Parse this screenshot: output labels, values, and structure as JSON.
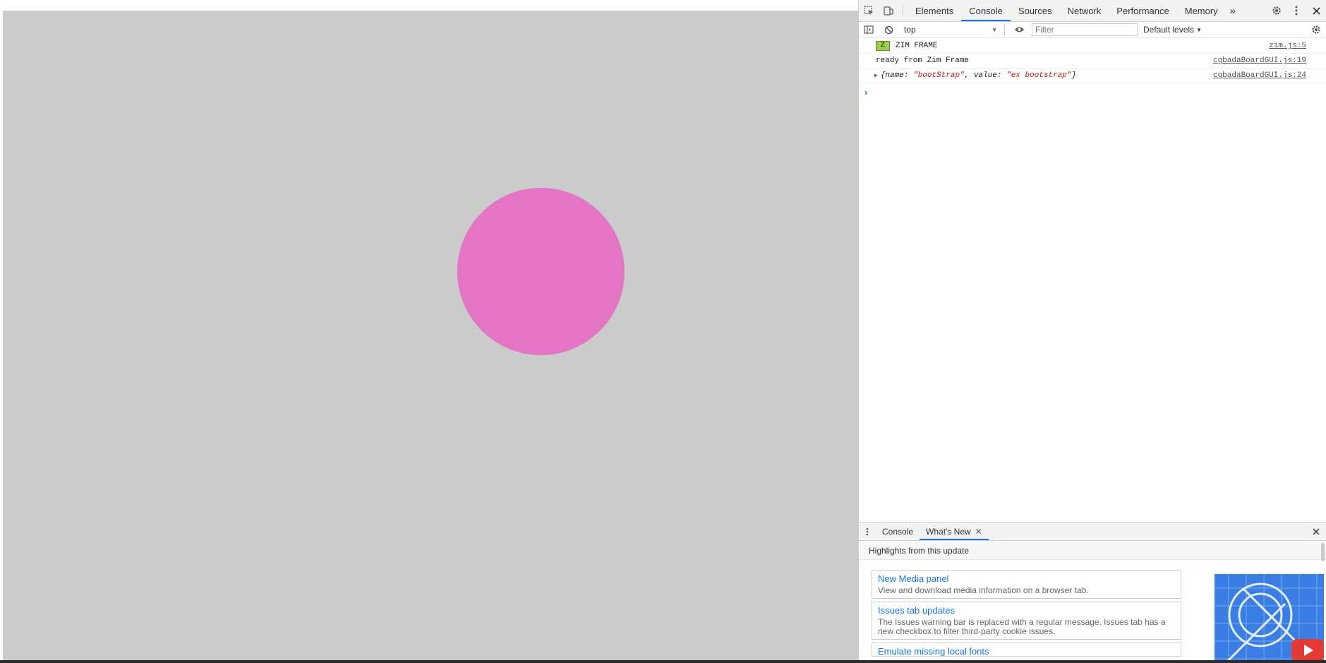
{
  "devtools": {
    "tabs": [
      "Elements",
      "Console",
      "Sources",
      "Network",
      "Performance",
      "Memory"
    ],
    "active_tab": "Console",
    "more_tabs_glyph": "»",
    "console_bar": {
      "context": "top",
      "filter_placeholder": "Filter",
      "levels": "Default levels"
    },
    "messages": [
      {
        "badge": "Z",
        "text": "ZIM FRAME",
        "source": "zim.js:5"
      },
      {
        "text": "ready from Zim Frame",
        "source": "cgbadaBoardGUI.js:19"
      },
      {
        "object": {
          "open": "{name: ",
          "name_val": "\"bootStrap\"",
          "mid": ", value: ",
          "value_val": "\"ex bootstrap\"",
          "close": "}"
        },
        "source": "cgbadaBoardGUI.js:24"
      }
    ],
    "prompt": "›",
    "drawer": {
      "tabs": [
        "Console",
        "What's New"
      ],
      "active_tab": "What's New",
      "highlights": "Highlights from this update",
      "cards": [
        {
          "title": "New Media panel",
          "desc": "View and download media information on a browser tab."
        },
        {
          "title": "Issues tab updates",
          "desc": "The Issues warning bar is replaced with a regular message. Issues tab has a new checkbox to filter third-party cookie issues."
        },
        {
          "title": "Emulate missing local fonts"
        }
      ]
    }
  },
  "colors": {
    "stage": "#cbcbcb",
    "circle": "#e474c4",
    "accent": "#1a73e8"
  },
  "icons": [
    "inspect-icon",
    "device-toolbar-icon",
    "settings-icon",
    "kebab-menu-icon",
    "close-icon",
    "sidebar-toggle-icon",
    "clear-console-icon",
    "eye-icon",
    "console-settings-icon",
    "expander-triangle-icon",
    "youtube-icon"
  ]
}
